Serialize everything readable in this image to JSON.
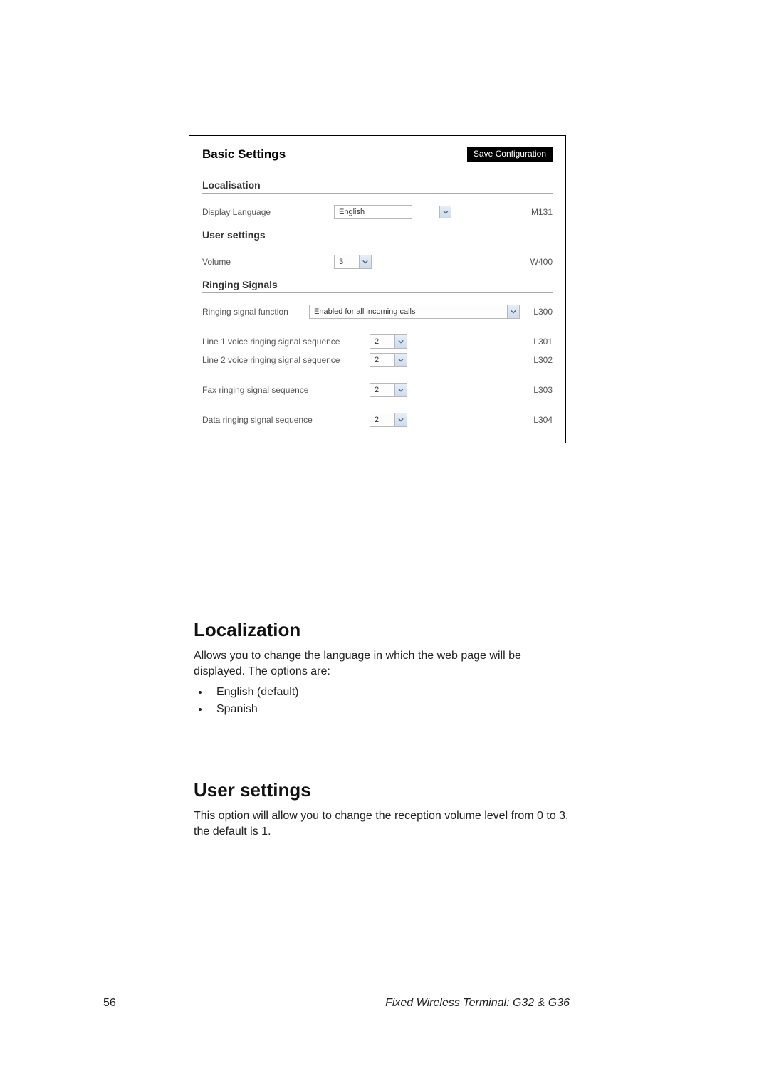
{
  "panel": {
    "title": "Basic Settings",
    "save_label": "Save Configuration",
    "sections": {
      "localisation": {
        "title": "Localisation",
        "display_language": {
          "label": "Display Language",
          "value": "English",
          "code": "M131"
        }
      },
      "user_settings": {
        "title": "User settings",
        "volume": {
          "label": "Volume",
          "value": "3",
          "code": "W400"
        }
      },
      "ringing_signals": {
        "title": "Ringing Signals",
        "function": {
          "label": "Ringing signal function",
          "value": "Enabled for all incoming calls",
          "code": "L300"
        },
        "line1": {
          "label": "Line 1 voice ringing signal sequence",
          "value": "2",
          "code": "L301"
        },
        "line2": {
          "label": "Line 2 voice ringing signal sequence",
          "value": "2",
          "code": "L302"
        },
        "fax": {
          "label": "Fax ringing signal sequence",
          "value": "2",
          "code": "L303"
        },
        "data": {
          "label": "Data ringing signal sequence",
          "value": "2",
          "code": "L304"
        }
      }
    }
  },
  "body": {
    "localization": {
      "heading": "Localization",
      "text": "Allows you to change the language in which the web page will be displayed. The options are:",
      "options": [
        "English (default)",
        "Spanish"
      ]
    },
    "user_settings": {
      "heading": "User settings",
      "text": "This option will allow you to change the reception volume level from 0 to 3, the default is 1."
    }
  },
  "footer": {
    "page_number": "56",
    "title": "Fixed Wireless Terminal: G32 & G36"
  }
}
